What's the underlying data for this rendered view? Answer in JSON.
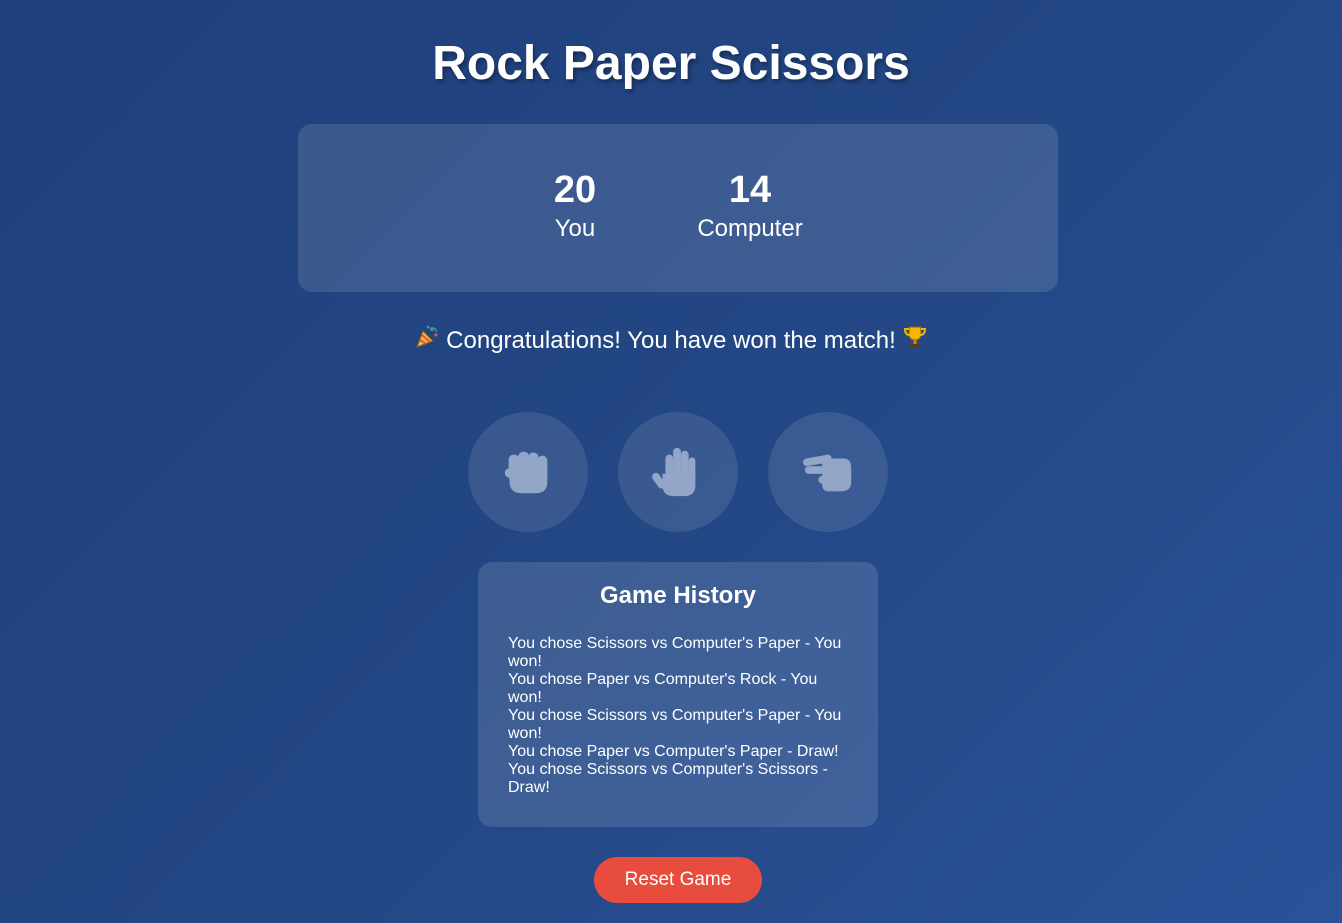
{
  "title": "Rock Paper Scissors",
  "scoreboard": {
    "player": {
      "score": "20",
      "label": "You"
    },
    "computer": {
      "score": "14",
      "label": "Computer"
    }
  },
  "message": {
    "text": "Congratulations! You have won the match!",
    "leading_emoji": "party-popper",
    "trailing_emoji": "trophy"
  },
  "choices": [
    {
      "name": "Rock",
      "icon": "rock-fist-icon"
    },
    {
      "name": "Paper",
      "icon": "paper-hand-icon"
    },
    {
      "name": "Scissors",
      "icon": "scissors-hand-icon"
    }
  ],
  "history": {
    "title": "Game History",
    "entries": [
      "You chose Scissors vs Computer's Paper - You won!",
      "You chose Paper vs Computer's Rock - You won!",
      "You chose Scissors vs Computer's Paper - You won!",
      "You chose Paper vs Computer's Paper - Draw!",
      "You chose Scissors vs Computer's Scissors - Draw!"
    ]
  },
  "reset_label": "Reset Game",
  "colors": {
    "background": "#234784",
    "reset_button": "#e74c3c",
    "icon_fill": "#93a6c8"
  }
}
